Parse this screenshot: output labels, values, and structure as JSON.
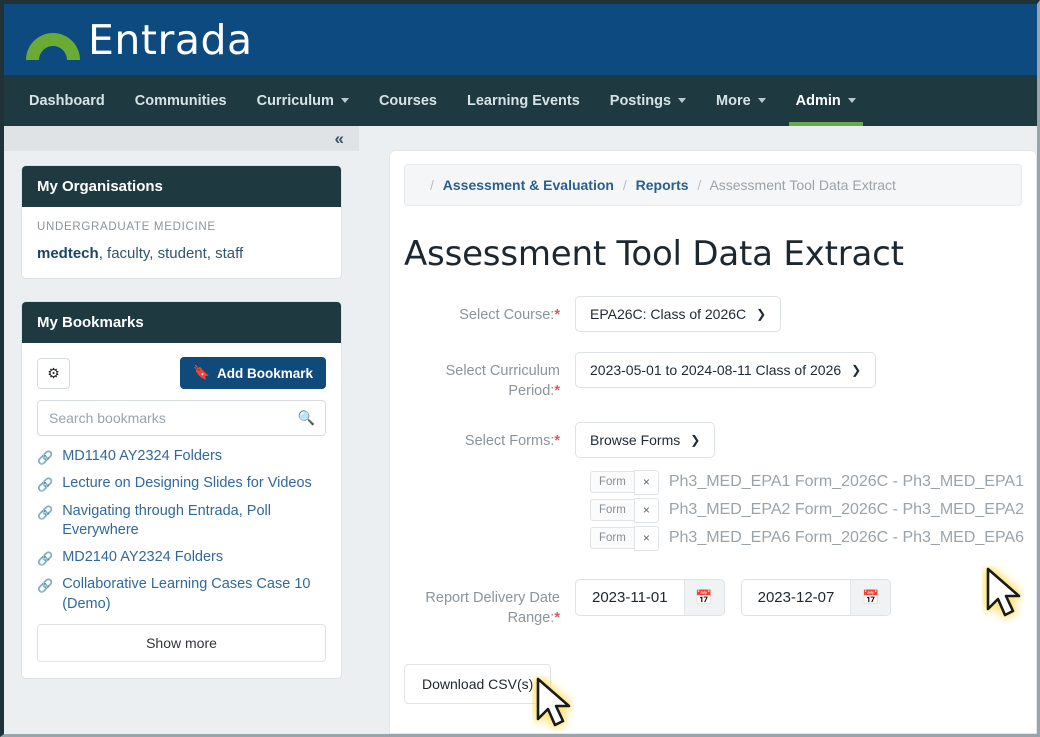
{
  "brand": {
    "name": "Entrada",
    "banner_color": "#0d4a80",
    "navbar_color": "#1e3a40",
    "accent_green": "#6aa84f",
    "logo_icon": "entrada-arc-logo"
  },
  "navbar": {
    "items": [
      {
        "label": "Dashboard",
        "has_caret": false,
        "active": false
      },
      {
        "label": "Communities",
        "has_caret": false,
        "active": false
      },
      {
        "label": "Curriculum",
        "has_caret": true,
        "active": false
      },
      {
        "label": "Courses",
        "has_caret": false,
        "active": false
      },
      {
        "label": "Learning Events",
        "has_caret": false,
        "active": false
      },
      {
        "label": "Postings",
        "has_caret": true,
        "active": false
      },
      {
        "label": "More",
        "has_caret": true,
        "active": false
      },
      {
        "label": "Admin",
        "has_caret": true,
        "active": true
      }
    ]
  },
  "sidebar": {
    "collapse_icon": "chevron-double-left-icon",
    "organisations": {
      "title": "My Organisations",
      "org_name": "UNDERGRADUATE MEDICINE",
      "primary_role": "medtech",
      "other_roles": ", faculty, student, staff"
    },
    "bookmarks": {
      "title": "My Bookmarks",
      "settings_icon": "gear-icon",
      "add_label": "Add Bookmark",
      "add_icon": "bookmark-icon",
      "search_placeholder": "Search bookmarks",
      "search_value": "",
      "search_icon": "search-icon",
      "items": [
        "MD1140 AY2324 Folders",
        "Lecture on Designing Slides for Videos",
        "Navigating through Entrada, Poll Everywhere",
        "MD2140 AY2324 Folders",
        "Collaborative Learning Cases Case 10 (Demo)"
      ],
      "show_more_label": "Show more"
    }
  },
  "main": {
    "breadcrumb": {
      "sep": "/",
      "items": [
        {
          "label": "Assessment & Evaluation",
          "current": false
        },
        {
          "label": "Reports",
          "current": false
        },
        {
          "label": "Assessment Tool Data Extract",
          "current": true
        }
      ]
    },
    "page_title": "Assessment Tool Data Extract",
    "form": {
      "course": {
        "label": "Select Course:",
        "required": true,
        "value": "EPA26C: Class of 2026C"
      },
      "curriculum_period": {
        "label": "Select Curriculum Period:",
        "required": true,
        "value": "2023-05-01 to 2024-08-11 Class of 2026"
      },
      "forms": {
        "label": "Select Forms:",
        "required": true,
        "browse_label": "Browse Forms",
        "chips": [
          {
            "tag": "Form",
            "remove": "×",
            "name": "Ph3_MED_EPA1 Form_2026C - Ph3_MED_EPA1"
          },
          {
            "tag": "Form",
            "remove": "×",
            "name": "Ph3_MED_EPA2 Form_2026C - Ph3_MED_EPA2"
          },
          {
            "tag": "Form",
            "remove": "×",
            "name": "Ph3_MED_EPA6 Form_2026C - Ph3_MED_EPA6"
          }
        ]
      },
      "date_range": {
        "label": "Report Delivery Date Range:",
        "required": true,
        "start": "2023-11-01",
        "end": "2023-12-07",
        "calendar_icon": "calendar-icon"
      },
      "download_label": "Download CSV(s)"
    }
  }
}
